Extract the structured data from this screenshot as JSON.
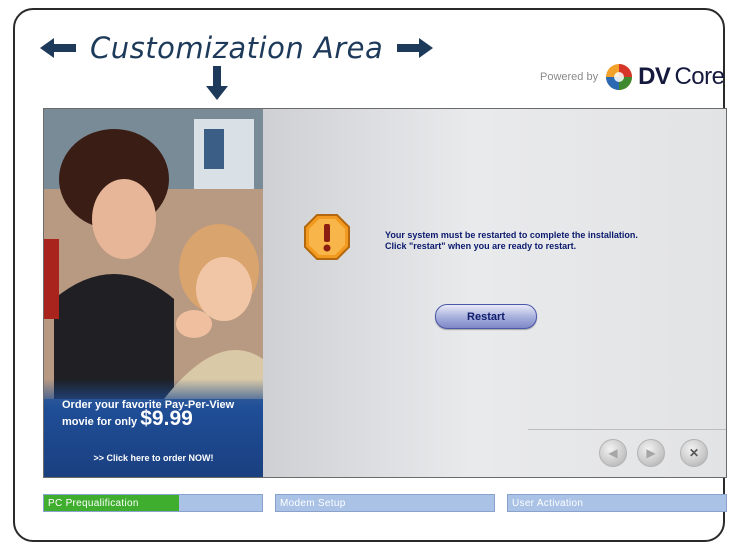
{
  "header": {
    "title": "Customization Area",
    "powered_by": "Powered by",
    "brand_bold": "DV",
    "brand_light": "Core"
  },
  "ad": {
    "line1": "Order your favorite Pay-Per-View movie for only",
    "price": "$9.99",
    "cta": ">> Click here to order NOW!"
  },
  "dialog": {
    "message_line1": "Your system must be restarted to complete the installation.",
    "message_line2": "Click \"restart\" when you are ready to restart.",
    "restart_label": "Restart",
    "icon": "warning-icon"
  },
  "nav": {
    "back_icon": "back-arrow-icon",
    "forward_icon": "forward-arrow-icon",
    "close_icon": "close-icon"
  },
  "steps": [
    {
      "label": "PC Prequalification",
      "progress": 0.62
    },
    {
      "label": "Modem Setup",
      "progress": 0
    },
    {
      "label": "User Activation",
      "progress": 0
    }
  ],
  "colors": {
    "accent": "#1e3a5a",
    "step_bar": "#a9c2e6",
    "progress_fill": "#3fae2f",
    "warning": "#f29a1f"
  }
}
